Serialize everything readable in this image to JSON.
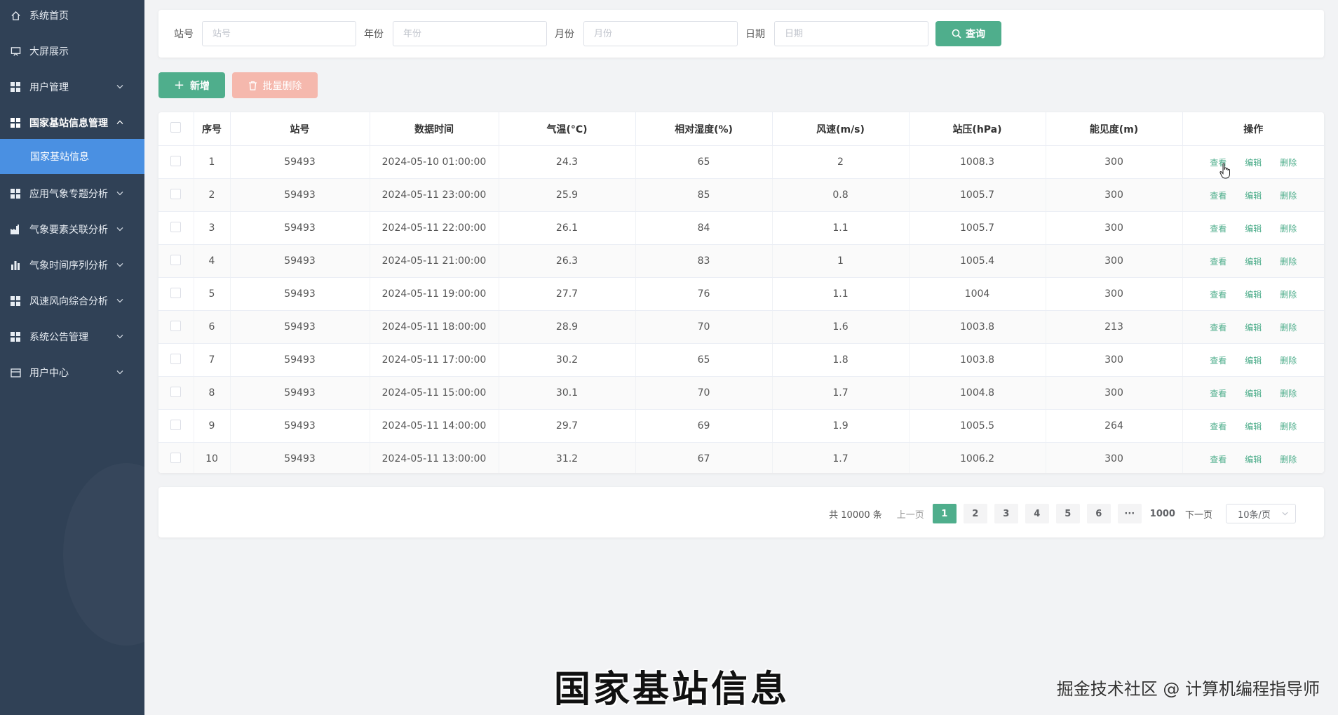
{
  "sidebar": {
    "items": [
      {
        "label": "系统首页",
        "icon": "home-icon"
      },
      {
        "label": "大屏展示",
        "icon": "screen-icon"
      },
      {
        "label": "用户管理",
        "icon": "grid-icon"
      },
      {
        "label": "国家基站信息管理",
        "icon": "grid-icon"
      },
      {
        "label": "应用气象专题分析",
        "icon": "grid-icon"
      },
      {
        "label": "气象要素关联分析",
        "icon": "factory-icon"
      },
      {
        "label": "气象时间序列分析",
        "icon": "bar-chart-icon"
      },
      {
        "label": "风速风向综合分析",
        "icon": "grid-icon"
      },
      {
        "label": "系统公告管理",
        "icon": "grid-icon"
      },
      {
        "label": "用户中心",
        "icon": "card-icon"
      }
    ],
    "active_sub": "国家基站信息",
    "colors": {
      "bg": "#304156",
      "active": "#4a90e2"
    }
  },
  "search": {
    "fields": [
      {
        "label": "站号",
        "placeholder": "站号"
      },
      {
        "label": "年份",
        "placeholder": "年份"
      },
      {
        "label": "月份",
        "placeholder": "月份"
      },
      {
        "label": "日期",
        "placeholder": "日期"
      }
    ],
    "query_label": "查询"
  },
  "actions": {
    "add_label": "新增",
    "batch_delete_label": "批量删除"
  },
  "table": {
    "headers": [
      "序号",
      "站号",
      "数据时间",
      "气温(°C)",
      "相对湿度(%)",
      "风速(m/s)",
      "站压(hPa)",
      "能见度(m)",
      "操作"
    ],
    "ops": {
      "view": "查看",
      "edit": "编辑",
      "delete": "删除"
    },
    "rows": [
      [
        "1",
        "59493",
        "2024-05-10 01:00:00",
        "24.3",
        "65",
        "2",
        "1008.3",
        "300"
      ],
      [
        "2",
        "59493",
        "2024-05-11 23:00:00",
        "25.9",
        "85",
        "0.8",
        "1005.7",
        "300"
      ],
      [
        "3",
        "59493",
        "2024-05-11 22:00:00",
        "26.1",
        "84",
        "1.1",
        "1005.7",
        "300"
      ],
      [
        "4",
        "59493",
        "2024-05-11 21:00:00",
        "26.3",
        "83",
        "1",
        "1005.4",
        "300"
      ],
      [
        "5",
        "59493",
        "2024-05-11 19:00:00",
        "27.7",
        "76",
        "1.1",
        "1004",
        "300"
      ],
      [
        "6",
        "59493",
        "2024-05-11 18:00:00",
        "28.9",
        "70",
        "1.6",
        "1003.8",
        "213"
      ],
      [
        "7",
        "59493",
        "2024-05-11 17:00:00",
        "30.2",
        "65",
        "1.8",
        "1003.8",
        "300"
      ],
      [
        "8",
        "59493",
        "2024-05-11 15:00:00",
        "30.1",
        "70",
        "1.7",
        "1004.8",
        "300"
      ],
      [
        "9",
        "59493",
        "2024-05-11 14:00:00",
        "29.7",
        "69",
        "1.9",
        "1005.5",
        "264"
      ],
      [
        "10",
        "59493",
        "2024-05-11 13:00:00",
        "31.2",
        "67",
        "1.7",
        "1006.2",
        "300"
      ]
    ]
  },
  "pagination": {
    "total": "共 10000 条",
    "prev": "上一页",
    "next": "下一页",
    "pages": [
      "1",
      "2",
      "3",
      "4",
      "5",
      "6",
      "···",
      "1000"
    ],
    "current": "1",
    "page_size": "10条/页"
  },
  "overlay": {
    "caption": "国家基站信息",
    "watermark": "掘金技术社区 @ 计算机编程指导师"
  },
  "accent_color": "#4fae8c",
  "danger_light_color": "#f5b8ad"
}
